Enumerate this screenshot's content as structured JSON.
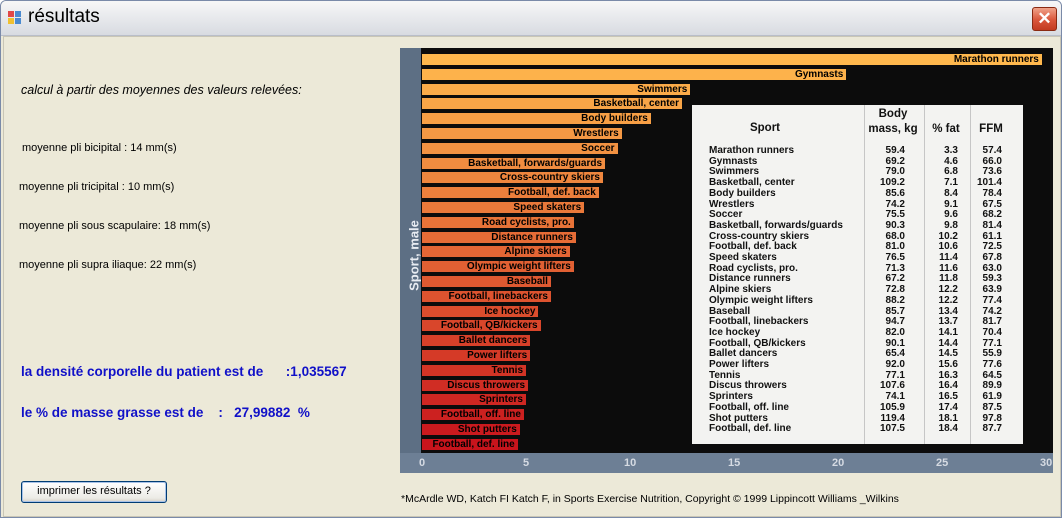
{
  "window": {
    "title": "résultats",
    "close": "✕"
  },
  "left": {
    "intro": "calcul à partir des moyennes des valeurs relevées:",
    "measures": [
      "moyenne pli bicipital : 14 mm(s)",
      "moyenne pli tricipital : 10 mm(s)",
      "moyenne pli sous scapulaire: 18 mm(s)",
      "moyenne pli supra iliaque: 22 mm(s)"
    ],
    "density": "la densité corporelle du patient est de      :1,035567",
    "fat": "le % de masse grasse est de    :   27,99882  %",
    "print_button": "imprimer les résultats  ?"
  },
  "footnote": "*McArdle WD, Katch FI  Katch F, in Sports  Exercise Nutrition, Copyright © 1999 Lippincott Williams _Wilkins",
  "chart_data": {
    "type": "bar",
    "orientation": "horizontal",
    "ylabel": "Sport, male",
    "xlim": [
      0,
      30
    ],
    "xticks": [
      0,
      5,
      10,
      15,
      20,
      25,
      30
    ],
    "categories": [
      "Marathon runners",
      "Gymnasts",
      "Swimmers",
      "Basketball, center",
      "Body builders",
      "Wrestlers",
      "Soccer",
      "Basketball, forwards/guards",
      "Cross-country skiers",
      "Football, def. back",
      "Speed skaters",
      "Road cyclists, pro.",
      "Distance runners",
      "Alpine skiers",
      "Olympic weight lifters",
      "Baseball",
      "Football, linebackers",
      "Ice hockey",
      "Football, QB/kickers",
      "Ballet dancers",
      "Power lifters",
      "Tennis",
      "Discus throwers",
      "Sprinters",
      "Football, off. line",
      "Shot putters",
      "Football, def. line"
    ],
    "values": [
      29.8,
      20.4,
      12.9,
      12.5,
      11.0,
      9.6,
      9.4,
      8.8,
      8.7,
      8.5,
      7.8,
      7.3,
      7.4,
      7.1,
      7.3,
      6.2,
      6.2,
      5.6,
      5.7,
      5.2,
      5.2,
      5.0,
      5.1,
      5.0,
      4.9,
      4.7,
      4.6
    ],
    "table": {
      "headers": {
        "sport": "Sport",
        "mass1": "Body",
        "mass2": "mass, kg",
        "fat": "% fat",
        "ffm": "FFM"
      },
      "rows": [
        [
          "Marathon runners",
          "59.4",
          "3.3",
          "57.4"
        ],
        [
          "Gymnasts",
          "69.2",
          "4.6",
          "66.0"
        ],
        [
          "Swimmers",
          "79.0",
          "6.8",
          "73.6"
        ],
        [
          "Basketball, center",
          "109.2",
          "7.1",
          "101.4"
        ],
        [
          "Body builders",
          "85.6",
          "8.4",
          "78.4"
        ],
        [
          "Wrestlers",
          "74.2",
          "9.1",
          "67.5"
        ],
        [
          "Soccer",
          "75.5",
          "9.6",
          "68.2"
        ],
        [
          "Basketball, forwards/guards",
          "90.3",
          "9.8",
          "81.4"
        ],
        [
          "Cross-country skiers",
          "68.0",
          "10.2",
          "61.1"
        ],
        [
          "Football, def. back",
          "81.0",
          "10.6",
          "72.5"
        ],
        [
          "Speed skaters",
          "76.5",
          "11.4",
          "67.8"
        ],
        [
          "Road cyclists, pro.",
          "71.3",
          "11.6",
          "63.0"
        ],
        [
          "Distance runners",
          "67.2",
          "11.8",
          "59.3"
        ],
        [
          "Alpine skiers",
          "72.8",
          "12.2",
          "63.9"
        ],
        [
          "Olympic weight lifters",
          "88.2",
          "12.2",
          "77.4"
        ],
        [
          "Baseball",
          "85.7",
          "13.4",
          "74.2"
        ],
        [
          "Football, linebackers",
          "94.7",
          "13.7",
          "81.7"
        ],
        [
          "Ice hockey",
          "82.0",
          "14.1",
          "70.4"
        ],
        [
          "Football, QB/kickers",
          "90.1",
          "14.4",
          "77.1"
        ],
        [
          "Ballet dancers",
          "65.4",
          "14.5",
          "55.9"
        ],
        [
          "Power lifters",
          "92.0",
          "15.6",
          "77.6"
        ],
        [
          "Tennis",
          "77.1",
          "16.3",
          "64.5"
        ],
        [
          "Discus throwers",
          "107.6",
          "16.4",
          "89.9"
        ],
        [
          "Sprinters",
          "74.1",
          "16.5",
          "61.9"
        ],
        [
          "Football, off. line",
          "105.9",
          "17.4",
          "87.5"
        ],
        [
          "Shot putters",
          "119.4",
          "18.1",
          "97.8"
        ],
        [
          "Football, def. line",
          "107.5",
          "18.4",
          "87.7"
        ]
      ]
    },
    "colors": {
      "top": "#ffb84d",
      "bottom": "#c8141c",
      "background": "#0c0c0c"
    }
  }
}
